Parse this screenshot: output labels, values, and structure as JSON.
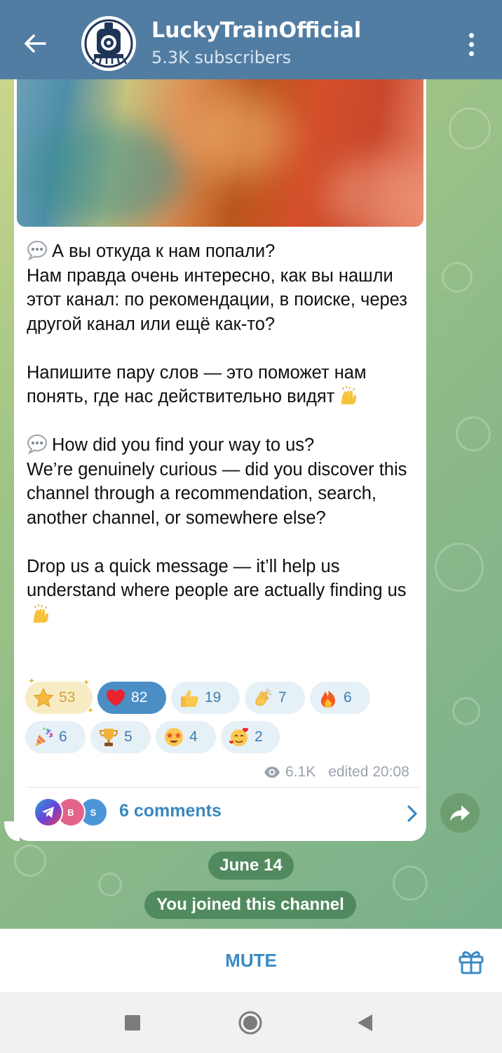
{
  "header": {
    "back_icon": "arrow-left-icon",
    "channel_name": "LuckyTrainOfficial",
    "subscribers": "5.3K subscribers",
    "menu_icon": "more-vertical-icon",
    "color": "#527da3"
  },
  "message": {
    "paragraphs": [
      {
        "text": "А вы откуда к нам попали?\nНам правда очень интересно, как вы нашли этот канал: по рекомендации, в поиске, через другой канал или ещё как-то?",
        "lead_icon": "speech-balloon-emoji"
      },
      {
        "text": "Напишите пару слов — это поможет нам понять, где нас действительно видят",
        "trail_icon": "raising-hands-emoji"
      },
      {
        "text": "How did you find your way to us?\nWe’re genuinely curious — did you discover this channel through a recommendation, search, another channel, or somewhere else?",
        "lead_icon": "speech-balloon-emoji"
      },
      {
        "text": "Drop us a quick message — it’ll help us understand where people are actually finding us",
        "trail_icon": "raising-hands-emoji"
      }
    ],
    "reactions_row1": [
      {
        "icon": "star-emoji",
        "count": "53",
        "style": "paid"
      },
      {
        "icon": "red-heart-emoji",
        "count": "82",
        "style": "selected"
      },
      {
        "icon": "thumbs-up-emoji",
        "count": "19",
        "style": "normal"
      },
      {
        "icon": "clapping-hands-emoji",
        "count": "7",
        "style": "normal"
      },
      {
        "icon": "fire-emoji",
        "count": "6",
        "style": "normal"
      }
    ],
    "reactions_row2": [
      {
        "icon": "party-popper-emoji",
        "count": "6",
        "style": "normal"
      },
      {
        "icon": "trophy-emoji",
        "count": "5",
        "style": "normal"
      },
      {
        "icon": "star-struck-emoji",
        "count": "4",
        "style": "normal"
      },
      {
        "icon": "smiling-face-with-hearts-emoji",
        "count": "2",
        "style": "normal"
      }
    ],
    "views": "6.1K",
    "edited": "edited 20:08",
    "comments": {
      "label": "6 comments",
      "avatars": [
        "telegram-logo-avatar",
        "B",
        "S"
      ]
    }
  },
  "service": {
    "date": "June 14",
    "joined": "You joined this channel"
  },
  "bottom": {
    "mute_label": "MUTE",
    "gift_icon": "gift-icon",
    "accent": "#3a8ac6"
  },
  "system_nav": [
    "square-icon",
    "home-circle-icon",
    "back-triangle-icon"
  ]
}
